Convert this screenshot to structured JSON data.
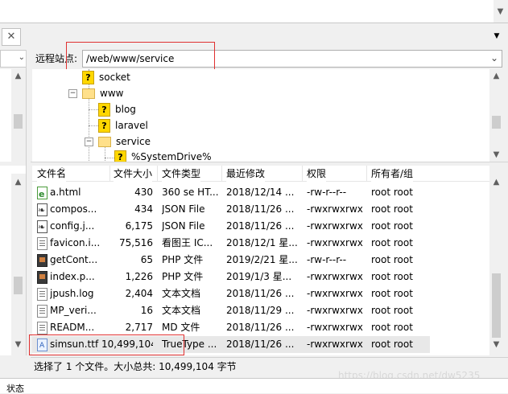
{
  "remote_site": {
    "label": "远程站点:",
    "path": "/web/www/service"
  },
  "tree": {
    "items": [
      {
        "label": "socket",
        "icon": "question-icon"
      },
      {
        "label": "www",
        "icon": "folder-icon"
      },
      {
        "label": "blog",
        "icon": "question-icon"
      },
      {
        "label": "laravel",
        "icon": "question-icon"
      },
      {
        "label": "service",
        "icon": "folder-icon"
      },
      {
        "label": "%SystemDrive%",
        "icon": "question-icon"
      }
    ]
  },
  "columns": [
    "文件名",
    "文件大小",
    "文件类型",
    "最近修改",
    "权限",
    "所有者/组"
  ],
  "files": [
    {
      "name": "a.html",
      "size": "430",
      "type": "360 se HT...",
      "modified": "2018/12/14 ...",
      "perm": "-rw-r--r--",
      "owner": "root root",
      "icon": "html-file-icon"
    },
    {
      "name": "compos...",
      "size": "434",
      "type": "JSON File",
      "modified": "2018/11/26 ...",
      "perm": "-rwxrwxrwx",
      "owner": "root root",
      "icon": "json-file-icon"
    },
    {
      "name": "config.j...",
      "size": "6,175",
      "type": "JSON File",
      "modified": "2018/11/26 ...",
      "perm": "-rwxrwxrwx",
      "owner": "root root",
      "icon": "json-file-icon"
    },
    {
      "name": "favicon.i...",
      "size": "75,516",
      "type": "看图王 IC...",
      "modified": "2018/12/1 星...",
      "perm": "-rwxrwxrwx",
      "owner": "root root",
      "icon": "ico-file-icon"
    },
    {
      "name": "getCont...",
      "size": "65",
      "type": "PHP 文件",
      "modified": "2019/2/21 星...",
      "perm": "-rw-r--r--",
      "owner": "root root",
      "icon": "php-file-icon"
    },
    {
      "name": "index.p...",
      "size": "1,226",
      "type": "PHP 文件",
      "modified": "2019/1/3 星...",
      "perm": "-rwxrwxrwx",
      "owner": "root root",
      "icon": "php-file-icon"
    },
    {
      "name": "jpush.log",
      "size": "2,404",
      "type": "文本文档",
      "modified": "2018/11/26 ...",
      "perm": "-rwxrwxrwx",
      "owner": "root root",
      "icon": "text-file-icon"
    },
    {
      "name": "MP_veri...",
      "size": "16",
      "type": "文本文档",
      "modified": "2018/11/29 ...",
      "perm": "-rwxrwxrwx",
      "owner": "root root",
      "icon": "text-file-icon"
    },
    {
      "name": "READM...",
      "size": "2,717",
      "type": "MD 文件",
      "modified": "2018/11/26 ...",
      "perm": "-rwxrwxrwx",
      "owner": "root root",
      "icon": "md-file-icon"
    },
    {
      "name": "simsun.ttf",
      "size": "10,499,104",
      "type": "TrueType ...",
      "modified": "2018/11/26 ...",
      "perm": "-rwxrwxrwx",
      "owner": "root root",
      "icon": "font-file-icon"
    }
  ],
  "status": {
    "selection": "选择了 1 个文件。大小总共: 10,499,104 字节",
    "bottom_label": "状态"
  },
  "watermark": "https://blog.csdn.net/dw5235"
}
